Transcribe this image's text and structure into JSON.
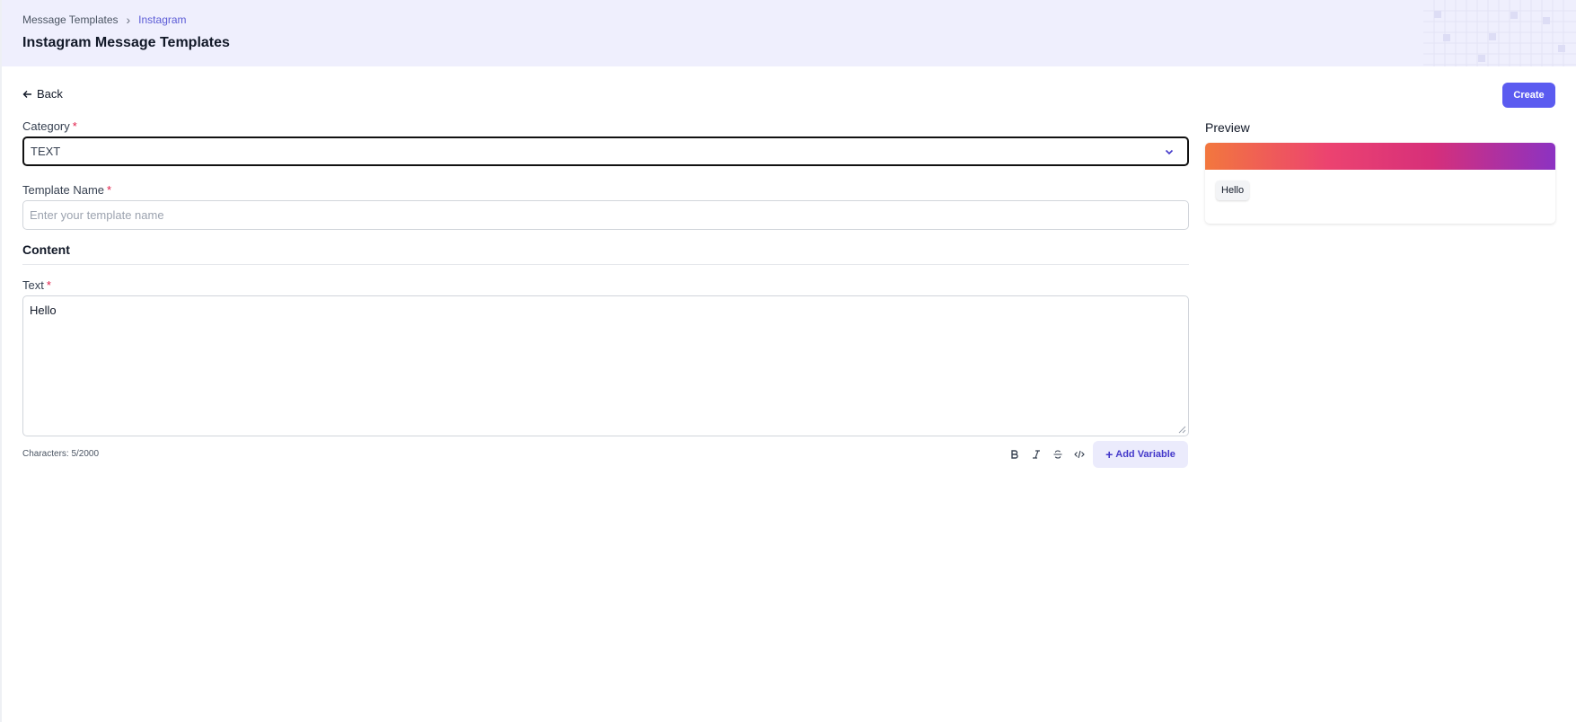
{
  "breadcrumb": {
    "parent": "Message Templates",
    "current": "Instagram"
  },
  "page_title": "Instagram Message Templates",
  "back_label": "Back",
  "create_label": "Create",
  "category": {
    "label": "Category",
    "required_mark": "*",
    "value": "TEXT"
  },
  "template_name": {
    "label": "Template Name",
    "required_mark": "*",
    "placeholder": "Enter your template name",
    "value": ""
  },
  "content": {
    "title": "Content"
  },
  "text_field": {
    "label": "Text",
    "required_mark": "*",
    "value": "Hello"
  },
  "char_count": "Characters: 5/2000",
  "toolbar": {
    "bold_icon": "bold-icon",
    "italic_icon": "italic-icon",
    "strike_icon": "strikethrough-icon",
    "code_icon": "code-icon",
    "add_variable_label": "Add Variable"
  },
  "preview": {
    "title": "Preview",
    "message": "Hello"
  },
  "colors": {
    "accent": "#5b5bf0",
    "header_bg": "#efeffd",
    "required": "#e11d48",
    "gradient": [
      "#f2773e",
      "#ec4370",
      "#8c32c2"
    ]
  }
}
